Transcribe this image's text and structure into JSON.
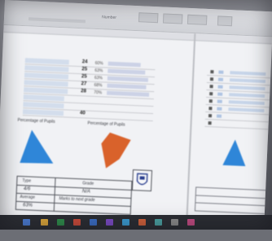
{
  "ribbon": {
    "label": "Number"
  },
  "left_block": {
    "rows": [
      {
        "count": "24",
        "pct": "60%"
      },
      {
        "count": "25",
        "pct": "63%"
      },
      {
        "count": "25",
        "pct": "63%"
      },
      {
        "count": "27",
        "pct": "68%"
      },
      {
        "count": "28",
        "pct": "70%"
      },
      {
        "count": "",
        "pct": ""
      },
      {
        "count": "",
        "pct": ""
      },
      {
        "count": "40",
        "pct": ""
      }
    ],
    "chart1_title": "Percentage of Pupils",
    "chart2_title": "Percentage of Pupils",
    "results": {
      "label_1": "Type",
      "label_2": "Grade",
      "value_1": "4/6",
      "value_2": "N/A",
      "label_3": "Average",
      "value_3": "Marks to next grade",
      "value_4": "63%"
    }
  },
  "colors": {
    "chart1_fill": "#2f86d8",
    "chart2_fill": "#d9622b",
    "chart3_fill": "#2f86d8",
    "row_highlight": "#4d7fc8",
    "crest": "#2a3f8f"
  }
}
